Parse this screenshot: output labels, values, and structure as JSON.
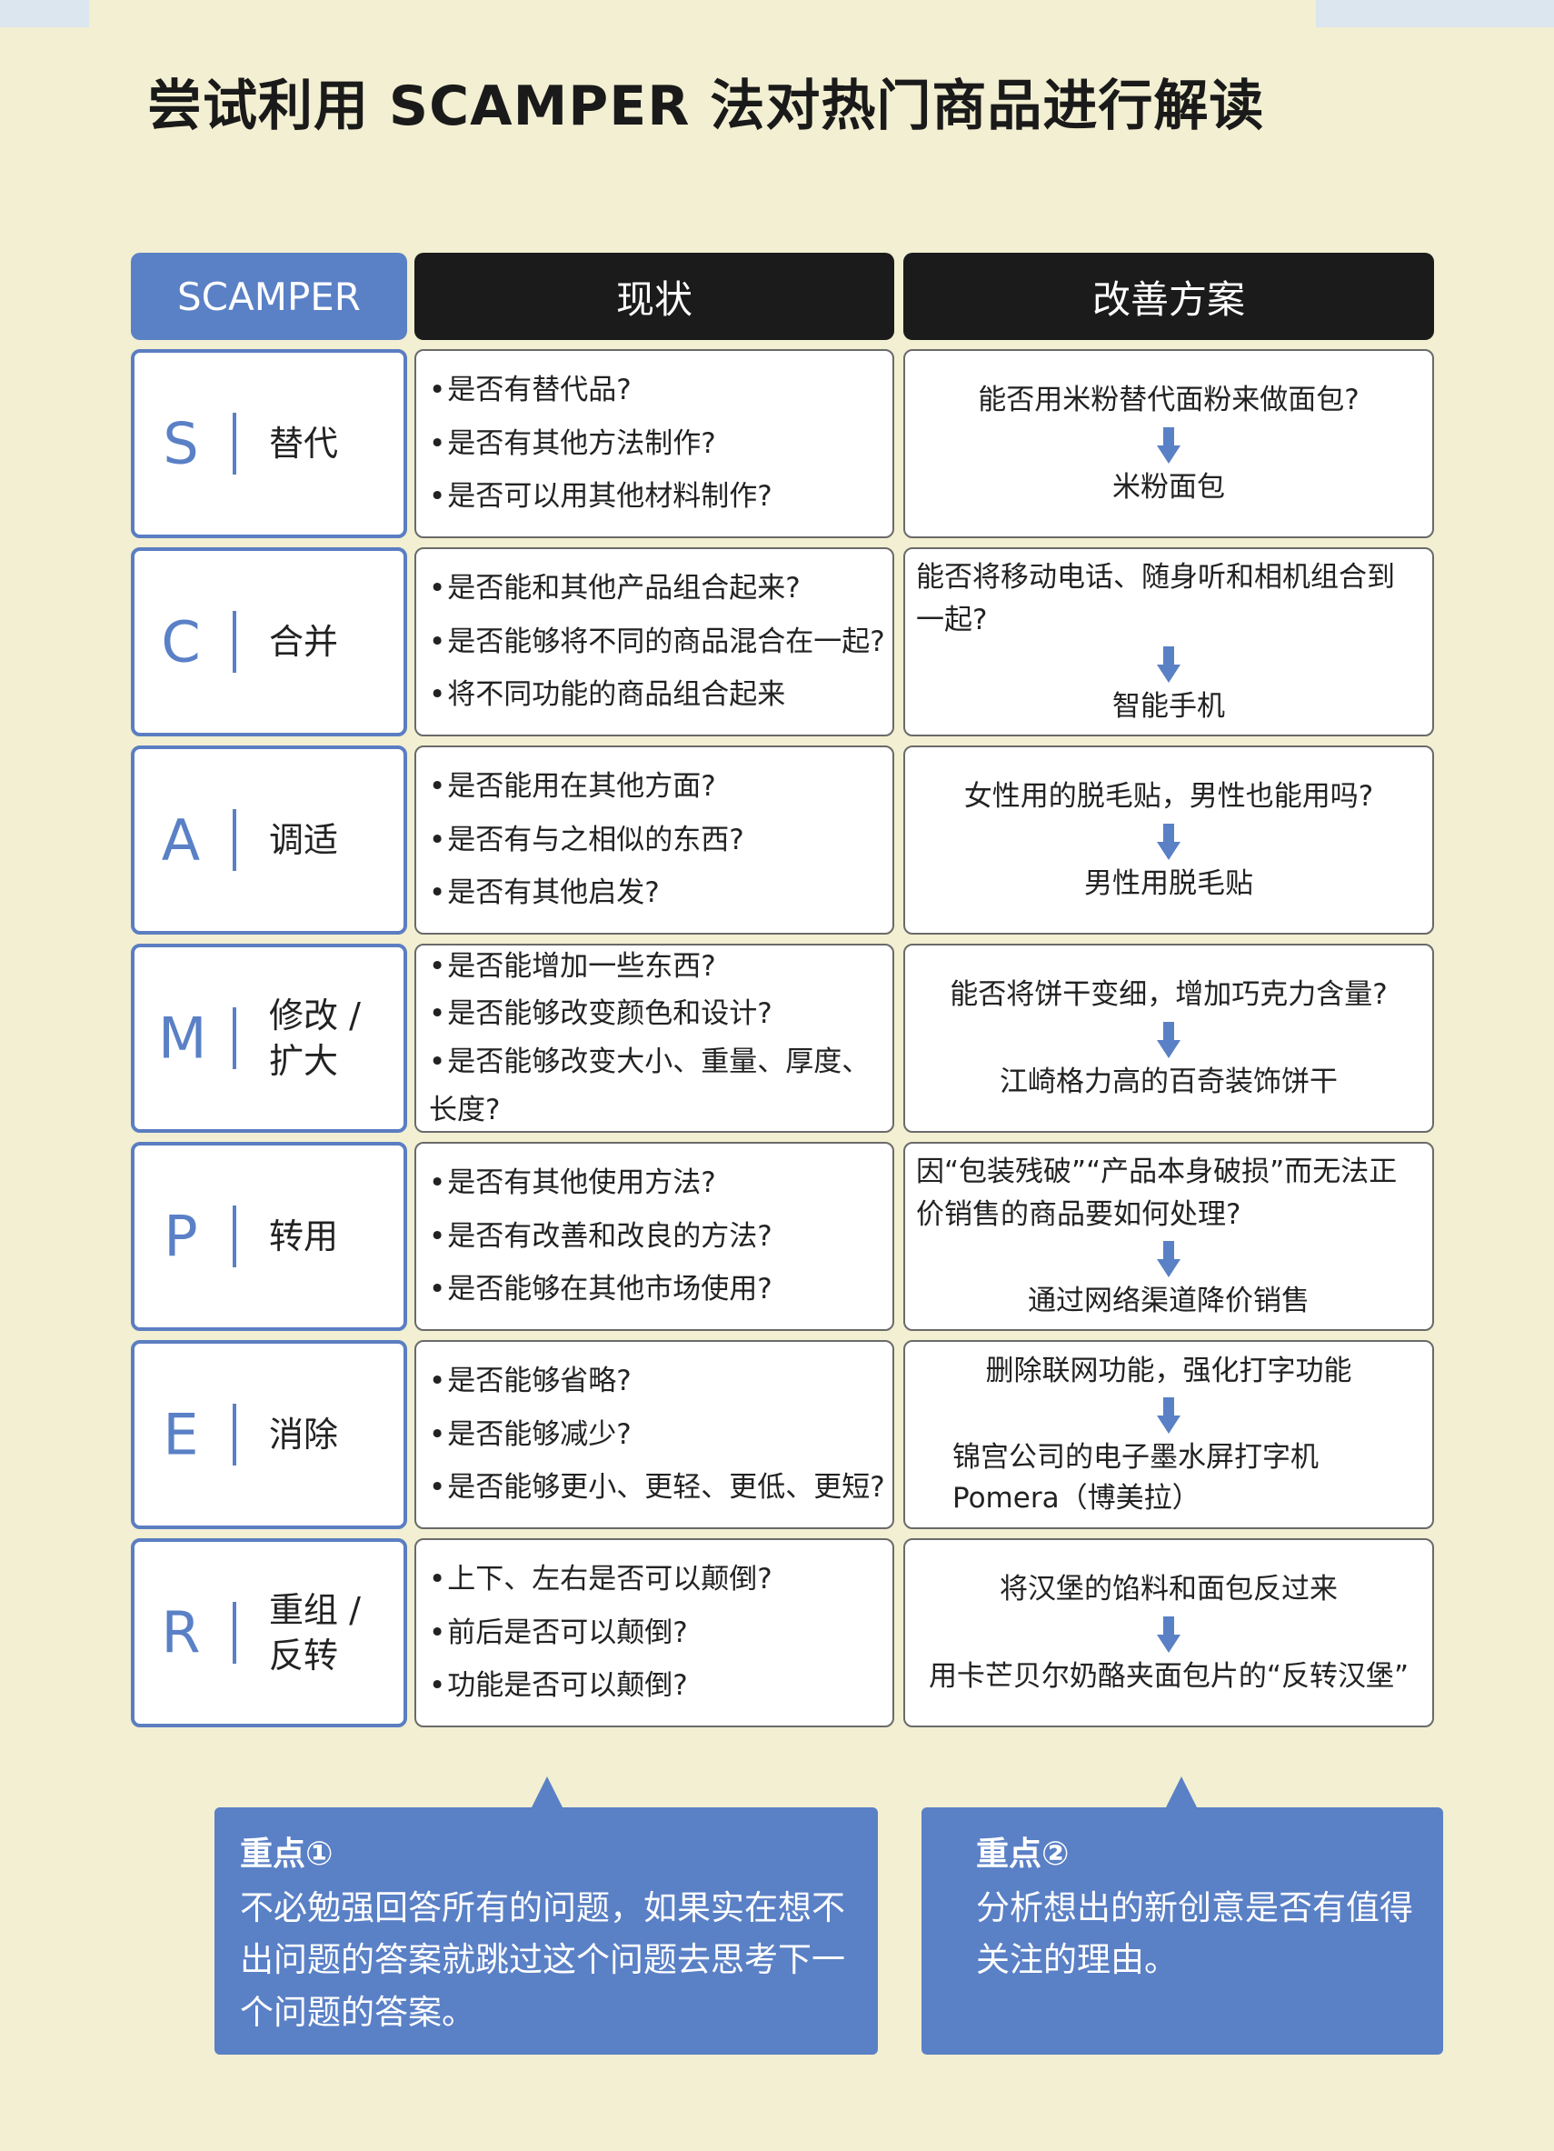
{
  "page": {
    "title": "尝试利用 SCAMPER 法对热门商品进行解读"
  },
  "header": {
    "col1": "SCAMPER",
    "col2": "现状",
    "col3": "改善方案"
  },
  "rows": [
    {
      "letter": "S",
      "name": "替代",
      "status": [
        "是否有替代品?",
        "是否有其他方法制作?",
        "是否可以用其他材料制作?"
      ],
      "question": "能否用米粉替代面粉来做面包?",
      "answer": "米粉面包"
    },
    {
      "letter": "C",
      "name": "合并",
      "status": [
        "是否能和其他产品组合起来?",
        "是否能够将不同的商品混合在一起?",
        "将不同功能的商品组合起来"
      ],
      "question": "能否将移动电话、随身听和相机组合到一起?",
      "answer": "智能手机"
    },
    {
      "letter": "A",
      "name": "调适",
      "status": [
        "是否能用在其他方面?",
        "是否有与之相似的东西?",
        "是否有其他启发?"
      ],
      "question": "女性用的脱毛贴，男性也能用吗?",
      "answer": "男性用脱毛贴"
    },
    {
      "letter": "M",
      "name": "修改 / 扩大",
      "status": [
        "是否能增加一些东西?",
        "是否能够改变颜色和设计?",
        "是否能够改变大小、重量、厚度、长度?"
      ],
      "question": "能否将饼干变细，增加巧克力含量?",
      "answer": "江崎格力高的百奇装饰饼干"
    },
    {
      "letter": "P",
      "name": "转用",
      "status": [
        "是否有其他使用方法?",
        "是否有改善和改良的方法?",
        "是否能够在其他市场使用?"
      ],
      "question": "因“包装残破”“产品本身破损”而无法正价销售的商品要如何处理?",
      "answer": "通过网络渠道降价销售"
    },
    {
      "letter": "E",
      "name": "消除",
      "status": [
        "是否能够省略?",
        "是否能够减少?",
        "是否能够更小、更轻、更低、更短?"
      ],
      "question": "删除联网功能，强化打字功能",
      "answer": "锦宫公司的电子墨水屏打字机 Pomera（博美拉）"
    },
    {
      "letter": "R",
      "name": "重组 / 反转",
      "status": [
        "上下、左右是否可以颠倒?",
        "前后是否可以颠倒?",
        "功能是否可以颠倒?"
      ],
      "question": "将汉堡的馅料和面包反过来",
      "answer": "用卡芒贝尔奶酪夹面包片的“反转汉堡”"
    }
  ],
  "notes": [
    {
      "title": "重点①",
      "text": "不必勉强回答所有的问题，如果实在想不出问题的答案就跳过这个问题去思考下一个问题的答案。"
    },
    {
      "title": "重点②",
      "text": "分析想出的新创意是否有值得关注的理由。"
    }
  ],
  "colors": {
    "accent_blue": "#5a80c6",
    "header_black": "#1b1b1b",
    "background": "#f2efd2"
  },
  "icons": {
    "arrow": "arrow-down-icon"
  }
}
